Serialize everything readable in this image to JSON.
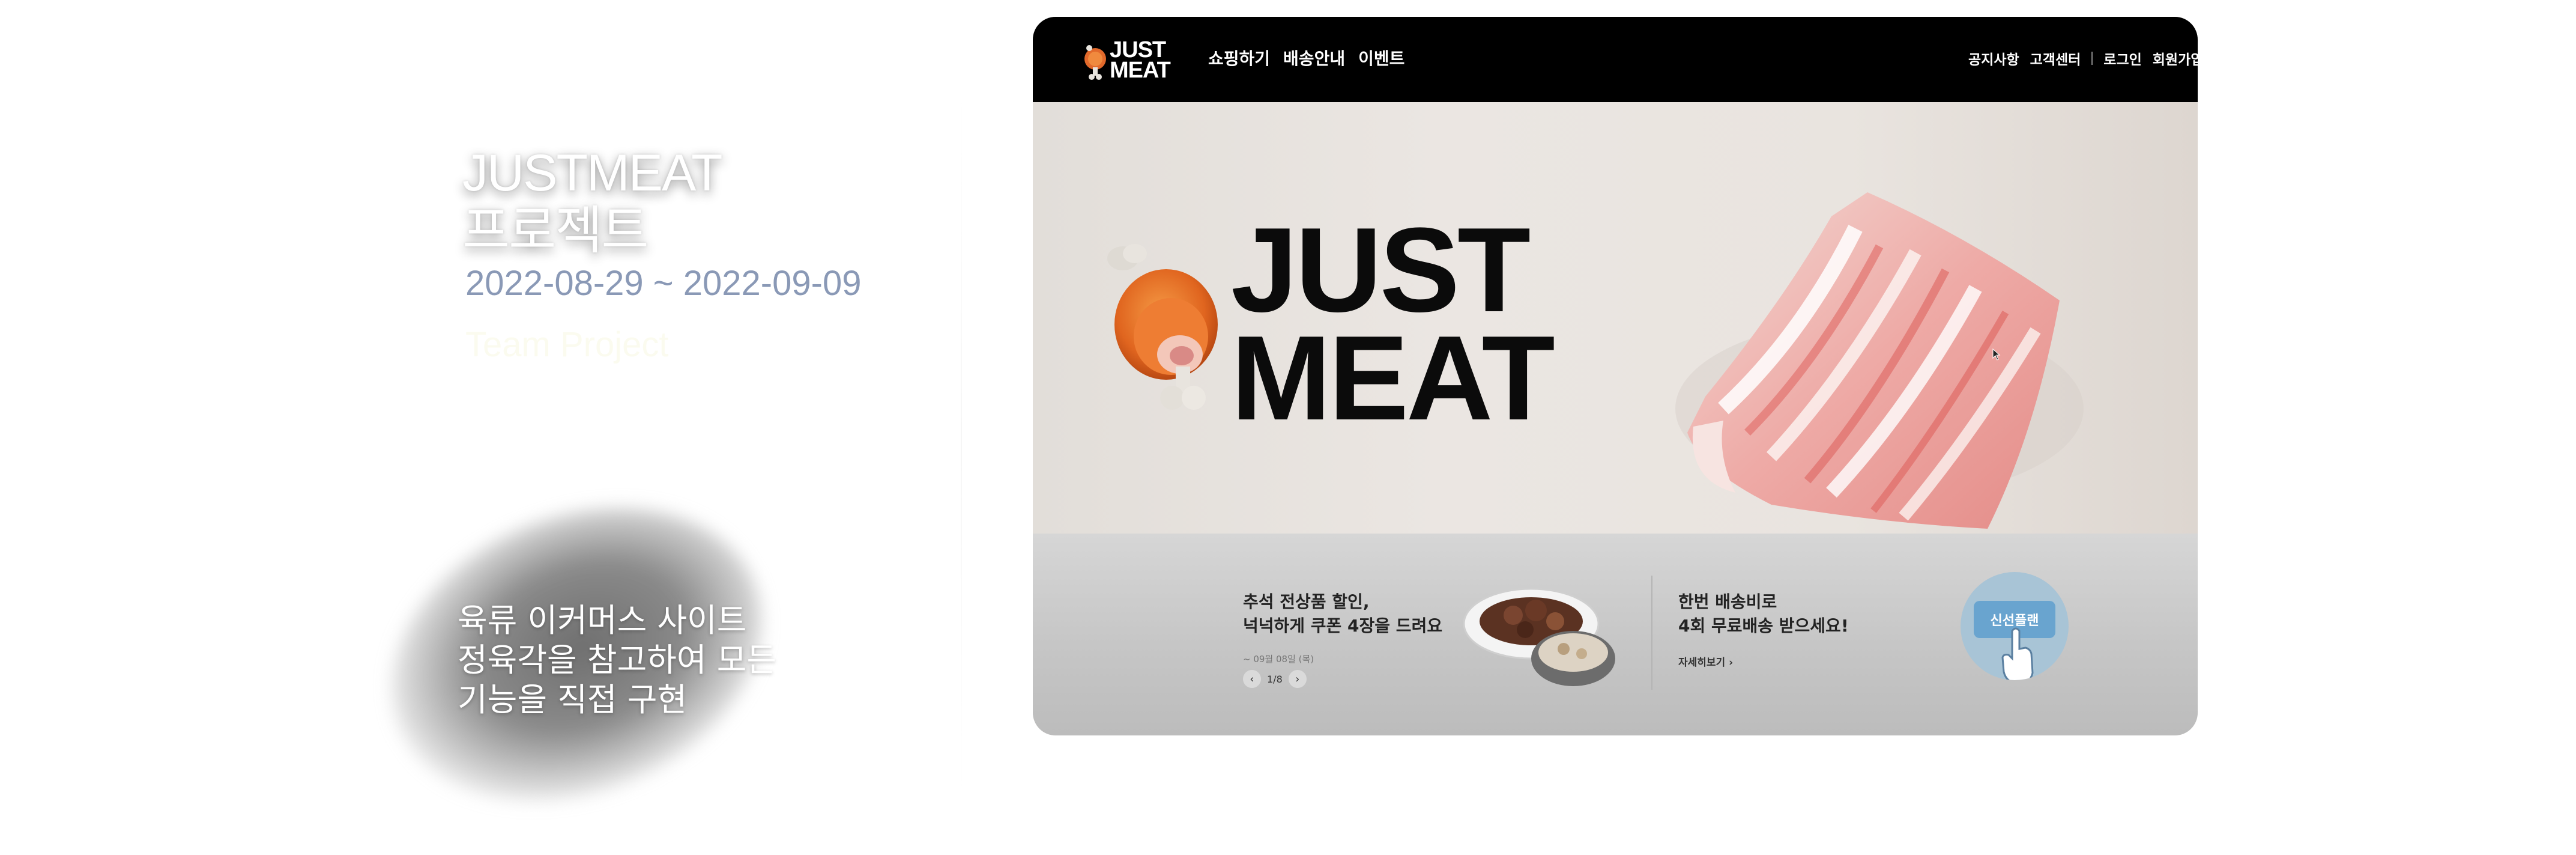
{
  "intro": {
    "title_line1": "JUSTMEAT",
    "title_line2": "프로젝트",
    "date_range": "2022-08-29 ~ 2022-09-09",
    "team_label": "Team Project",
    "description": [
      "육류 이커머스 사이트",
      "정육각을 참고하여 모든",
      "기능을 직접 구현"
    ]
  },
  "site": {
    "logo": {
      "line1": "JUST",
      "line2": "MEAT"
    },
    "main_nav": [
      "쇼핑하기",
      "배송안내",
      "이벤트"
    ],
    "util_nav": [
      "공지사항",
      "고객센터",
      "로그인",
      "회원가입"
    ],
    "hero": {
      "logo_line1": "JUST",
      "logo_line2": "MEAT",
      "image": "pork-belly-photo",
      "icon": "meat-leg-icon"
    },
    "promos": [
      {
        "title_line1": "추석 전상품 할인,",
        "title_line2": "넉넉하게 쿠폰 4장을 드려요",
        "date": "~ 09월 08일 (목)",
        "pager": "1/8",
        "image": "braised-dish-photo"
      },
      {
        "title_line1": "한번 배송비로",
        "title_line2": "4회 무료배송 받으세요!",
        "link": "자세히보기 ›",
        "coupon_label": "신선플랜",
        "image": "coupon-hand-icon"
      }
    ]
  },
  "colors": {
    "header_bg": "#000000",
    "date_text": "#8a99b6",
    "coupon_blue": "#69a4cf"
  }
}
